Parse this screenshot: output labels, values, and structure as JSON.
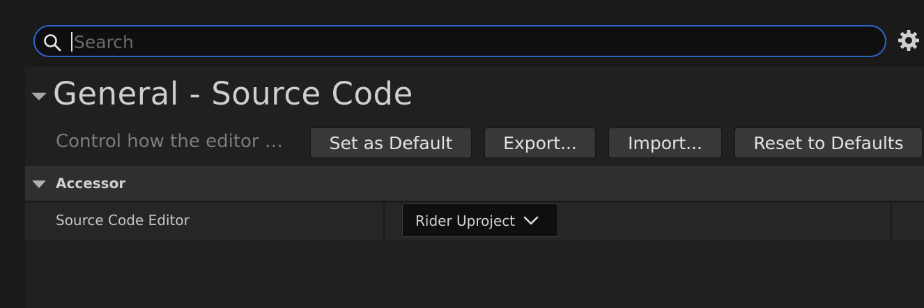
{
  "search": {
    "placeholder": "Search"
  },
  "icons": {
    "search": "search-icon",
    "settings": "gear-icon",
    "collapse": "triangle-down-icon",
    "dropdown": "chevron-down-icon"
  },
  "colors": {
    "accent": "#2e64c8",
    "background": "#1a1a1a",
    "panel": "#202020",
    "button": "#383838"
  },
  "section": {
    "title": "General - Source Code",
    "description": "Control how the editor ac...",
    "buttons": {
      "set_default": "Set as Default",
      "export": "Export...",
      "import": "Import...",
      "reset": "Reset to Defaults"
    }
  },
  "category": {
    "label": "Accessor"
  },
  "property": {
    "label": "Source Code Editor",
    "value": "Rider Uproject"
  }
}
